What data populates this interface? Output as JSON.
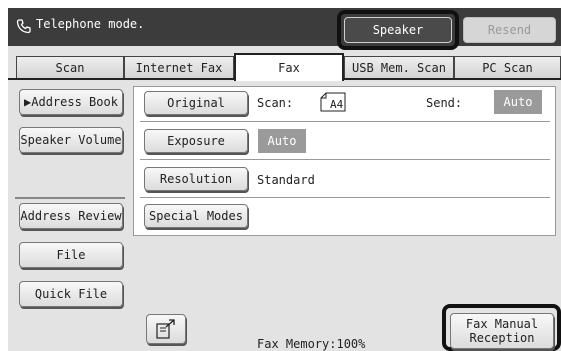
{
  "header": {
    "mode_label": "Telephone mode.",
    "speaker_label": "Speaker",
    "resend_label": "Resend"
  },
  "tabs": [
    {
      "label": "Scan"
    },
    {
      "label": "Internet Fax"
    },
    {
      "label": "Fax"
    },
    {
      "label": "USB Mem. Scan"
    },
    {
      "label": "PC Scan"
    }
  ],
  "sidebar": {
    "address_book": "▶Address Book",
    "speaker_volume": "Speaker Volume",
    "address_review": "Address Review",
    "file": "File",
    "quick_file": "Quick File"
  },
  "settings": {
    "original_button": "Original",
    "scan_label": "Scan:",
    "scan_size": "A4",
    "send_label": "Send:",
    "send_value": "Auto",
    "exposure_button": "Exposure",
    "exposure_value": "Auto",
    "resolution_button": "Resolution",
    "resolution_value": "Standard",
    "special_modes_button": "Special Modes"
  },
  "footer": {
    "fax_memory": "Fax Memory:100%",
    "fax_manual_reception_line1": "Fax Manual",
    "fax_manual_reception_line2": "Reception"
  },
  "icons": {
    "telephone": "handset-icon",
    "document_export": "document-arrow-icon",
    "paper_size": "paper-sheet-icon"
  },
  "colors": {
    "topbar": "#3c3c3c",
    "highlight_border": "#111111",
    "auto_badge": "#9a9a9a"
  }
}
